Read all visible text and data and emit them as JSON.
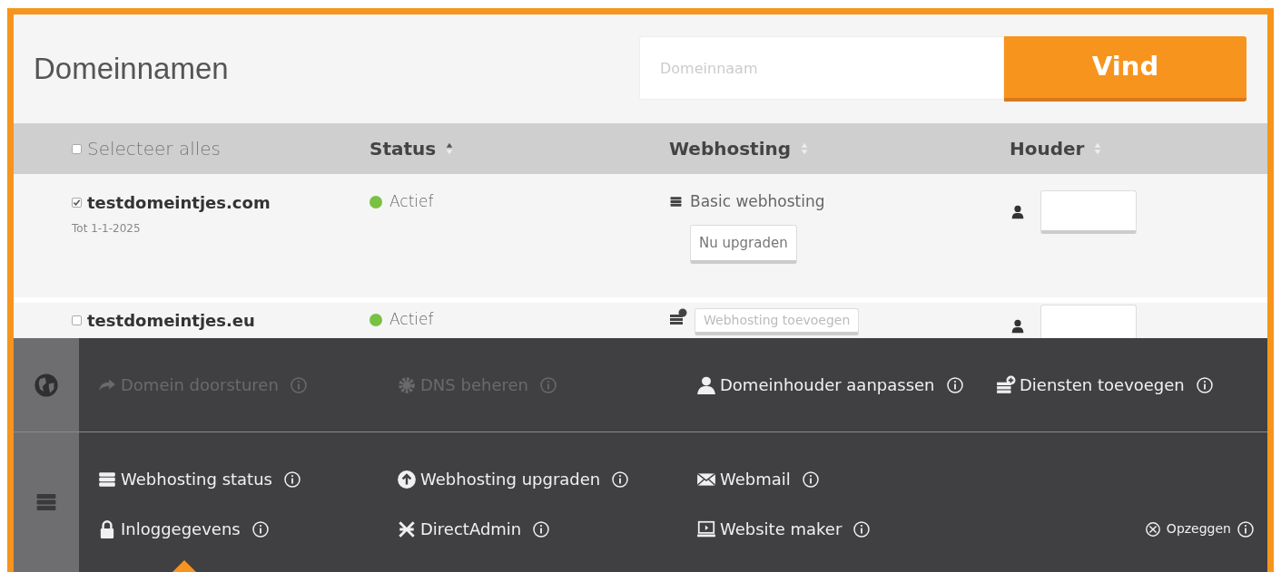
{
  "header": {
    "title": "Domeinnamen",
    "search": {
      "placeholder": "Domeinnaam"
    },
    "search_button": "Vind"
  },
  "table": {
    "columns": [
      {
        "kind": "select",
        "label": "Selecteer alles",
        "checked": false
      },
      {
        "kind": "sort",
        "label": "Status",
        "sorted": true
      },
      {
        "kind": "sort",
        "label": "Webhosting",
        "sorted": false
      },
      {
        "kind": "sort",
        "label": "Houder",
        "sorted": false
      }
    ],
    "rows": [
      {
        "domain": "testdomeintjes.com",
        "checked": true,
        "expiry": "Tot 1-1-2025",
        "status": "Actief",
        "color": "#7ac143",
        "webhosting": {
          "kind": "package",
          "name": "Basic webhosting",
          "button": "Nu upgraden"
        }
      },
      {
        "domain": "testdomeintjes.eu",
        "checked": false,
        "status": "Actief",
        "color": "#7ac143",
        "webhosting": {
          "kind": "add",
          "button": "Webhosting toevoegen"
        }
      }
    ]
  },
  "panel": {
    "sections": [
      {
        "rows": [
          [
            {
              "label": "Domein doorsturen",
              "disabled": true
            },
            {
              "label": "DNS beheren",
              "disabled": true
            },
            {
              "label": "Domeinhouder aanpassen",
              "disabled": false
            },
            {
              "label": "Diensten toevoegen",
              "disabled": false
            }
          ]
        ]
      },
      {
        "rows": [
          [
            {
              "label": "Webhosting status",
              "disabled": false
            },
            {
              "label": "Webhosting upgraden",
              "disabled": false
            },
            {
              "label": "Webmail",
              "disabled": false
            }
          ],
          [
            {
              "label": "Inloggegevens",
              "disabled": false
            },
            {
              "label": "DirectAdmin",
              "disabled": false
            },
            {
              "label": "Website maker",
              "disabled": false
            }
          ]
        ],
        "cancel": "Opzeggen"
      }
    ]
  }
}
